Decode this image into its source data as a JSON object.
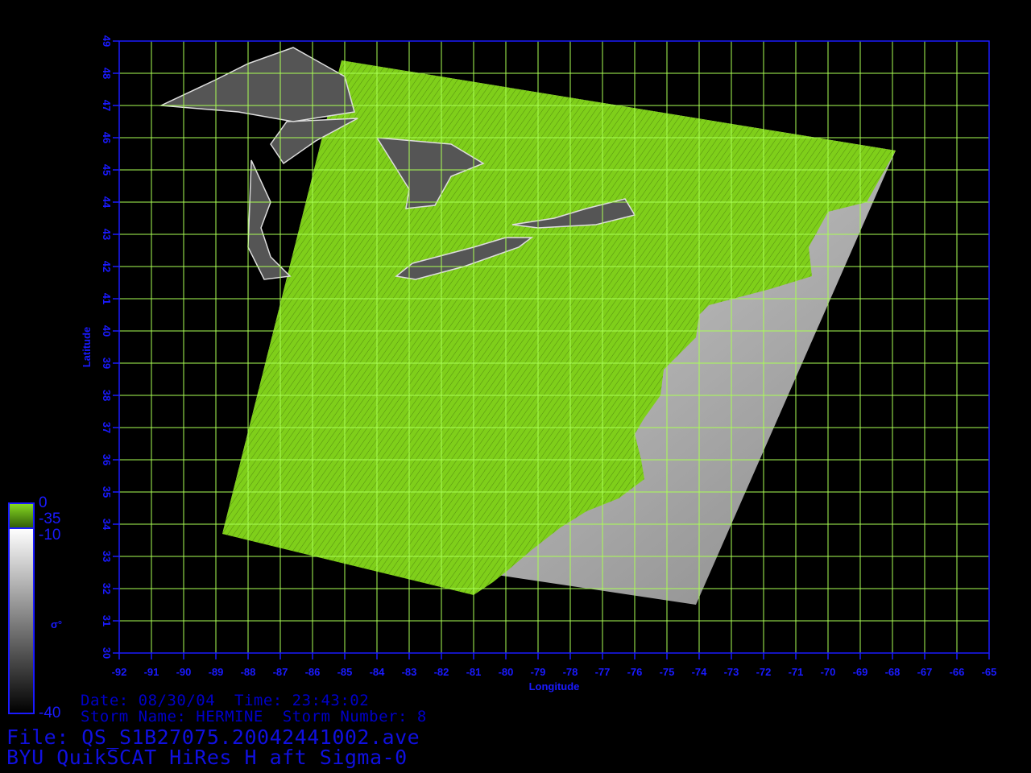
{
  "colors": {
    "background": "#000000",
    "frame": "#1a1aff",
    "grid": "#aaff55",
    "land": "#7fcf1a",
    "text": "#1a1aff"
  },
  "map": {
    "type": "satellite-sigma0-swath",
    "x_axis": {
      "label": "Longitude",
      "min": -92,
      "max": -65,
      "ticks": [
        "-92",
        "-91",
        "-90",
        "-89",
        "-88",
        "-87",
        "-86",
        "-85",
        "-84",
        "-83",
        "-82",
        "-81",
        "-80",
        "-79",
        "-78",
        "-77",
        "-76",
        "-75",
        "-74",
        "-73",
        "-72",
        "-71",
        "-70",
        "-69",
        "-68",
        "-67",
        "-66",
        "-65"
      ]
    },
    "y_axis": {
      "label": "Latitude",
      "min": 30,
      "max": 49,
      "ticks": [
        "30",
        "31",
        "32",
        "33",
        "34",
        "35",
        "36",
        "37",
        "38",
        "39",
        "40",
        "41",
        "42",
        "43",
        "44",
        "45",
        "46",
        "47",
        "48",
        "49"
      ]
    },
    "grid": true,
    "swath_corners_lonlat": [
      [
        -85.1,
        48.4
      ],
      [
        -67.9,
        45.6
      ],
      [
        -74.1,
        31.5
      ],
      [
        -88.8,
        33.7
      ]
    ],
    "land_boundary_lonlat": [
      [
        -85.1,
        48.4
      ],
      [
        -67.9,
        45.6
      ],
      [
        -68.8,
        44.0
      ],
      [
        -70.0,
        43.7
      ],
      [
        -70.6,
        42.6
      ],
      [
        -70.5,
        41.7
      ],
      [
        -71.8,
        41.3
      ],
      [
        -73.7,
        40.8
      ],
      [
        -74.0,
        40.5
      ],
      [
        -74.1,
        39.8
      ],
      [
        -74.6,
        39.3
      ],
      [
        -75.1,
        38.8
      ],
      [
        -75.2,
        38.0
      ],
      [
        -75.7,
        37.3
      ],
      [
        -76.0,
        36.8
      ],
      [
        -75.8,
        36.0
      ],
      [
        -75.7,
        35.4
      ],
      [
        -76.5,
        34.8
      ],
      [
        -77.5,
        34.4
      ],
      [
        -78.3,
        33.9
      ],
      [
        -79.2,
        33.2
      ],
      [
        -79.9,
        32.6
      ],
      [
        -80.4,
        32.2
      ],
      [
        -81.0,
        31.8
      ],
      [
        -88.8,
        33.7
      ]
    ],
    "lakes_lonlat": [
      [
        [
          -84.6,
          46.6
        ],
        [
          -86.8,
          46.5
        ],
        [
          -87.3,
          45.8
        ],
        [
          -86.9,
          45.2
        ],
        [
          -85.9,
          45.9
        ],
        [
          -84.6,
          46.6
        ]
      ],
      [
        [
          -87.9,
          45.3
        ],
        [
          -87.3,
          44.0
        ],
        [
          -87.6,
          43.2
        ],
        [
          -87.3,
          42.3
        ],
        [
          -86.7,
          41.7
        ],
        [
          -87.5,
          41.6
        ],
        [
          -88.0,
          42.6
        ],
        [
          -87.9,
          45.3
        ]
      ],
      [
        [
          -84.0,
          46.0
        ],
        [
          -83.5,
          45.2
        ],
        [
          -83.0,
          44.4
        ],
        [
          -83.1,
          43.8
        ],
        [
          -82.2,
          43.9
        ],
        [
          -81.7,
          44.8
        ],
        [
          -80.7,
          45.2
        ],
        [
          -81.7,
          45.8
        ],
        [
          -84.0,
          46.0
        ]
      ],
      [
        [
          -82.9,
          42.1
        ],
        [
          -81.0,
          42.6
        ],
        [
          -80.0,
          42.9
        ],
        [
          -79.2,
          42.9
        ],
        [
          -79.6,
          42.6
        ],
        [
          -81.3,
          42.0
        ],
        [
          -82.8,
          41.6
        ],
        [
          -83.4,
          41.7
        ],
        [
          -82.9,
          42.1
        ]
      ],
      [
        [
          -79.8,
          43.3
        ],
        [
          -78.5,
          43.5
        ],
        [
          -77.5,
          43.8
        ],
        [
          -76.3,
          44.1
        ],
        [
          -76.0,
          43.6
        ],
        [
          -77.2,
          43.3
        ],
        [
          -79.0,
          43.2
        ],
        [
          -79.8,
          43.3
        ]
      ],
      [
        [
          -90.7,
          47.0
        ],
        [
          -89.0,
          47.8
        ],
        [
          -88.0,
          48.3
        ],
        [
          -86.6,
          48.8
        ],
        [
          -85.0,
          47.9
        ],
        [
          -84.7,
          46.8
        ],
        [
          -86.6,
          46.5
        ],
        [
          -88.3,
          46.8
        ],
        [
          -90.7,
          47.0
        ]
      ]
    ]
  },
  "colorbar": {
    "label": "σ°",
    "scale_top_max": "0",
    "scale_top_min": "-35",
    "scale_bottom_max": "-10",
    "scale_bottom_min": "-40"
  },
  "info": {
    "line1": "Date: 08/30/04  Time: 23:43:02",
    "line2": "Storm Name: HERMINE  Storm Number: 8",
    "file_line": "File: QS_S1B27075.20042441002.ave",
    "product_line": "BYU QuikSCAT HiRes H aft Sigma-0"
  }
}
